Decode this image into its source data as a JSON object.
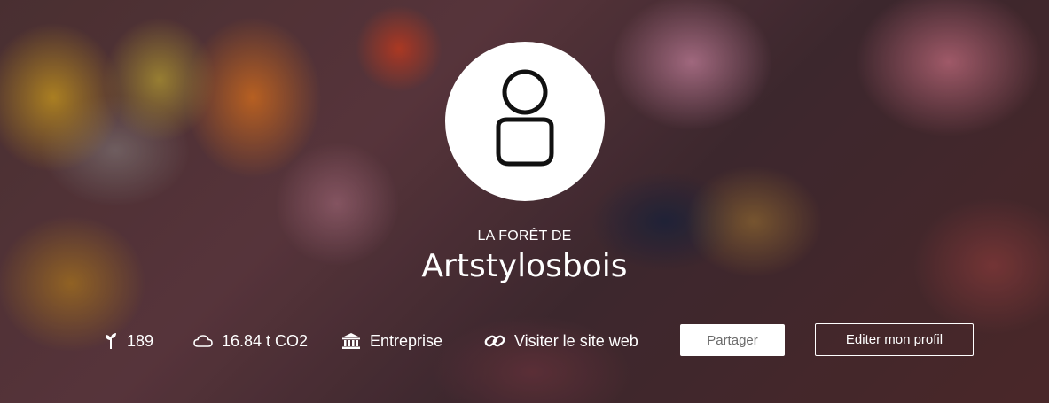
{
  "header": {
    "subtitle": "LA FORÊT DE",
    "title": "Artstylosbois"
  },
  "stats": {
    "trees": {
      "icon": "sprout-icon",
      "value": "189"
    },
    "co2": {
      "icon": "cloud-icon",
      "value": "16.84 t CO2"
    },
    "type": {
      "icon": "institution-icon",
      "value": "Entreprise"
    },
    "website": {
      "icon": "link-icon",
      "label": "Visiter le site web"
    }
  },
  "actions": {
    "share_label": "Partager",
    "edit_label": "Editer mon profil"
  },
  "colors": {
    "text": "#ffffff",
    "share_button_bg": "#ffffff",
    "share_button_text": "#6a6a6a"
  }
}
